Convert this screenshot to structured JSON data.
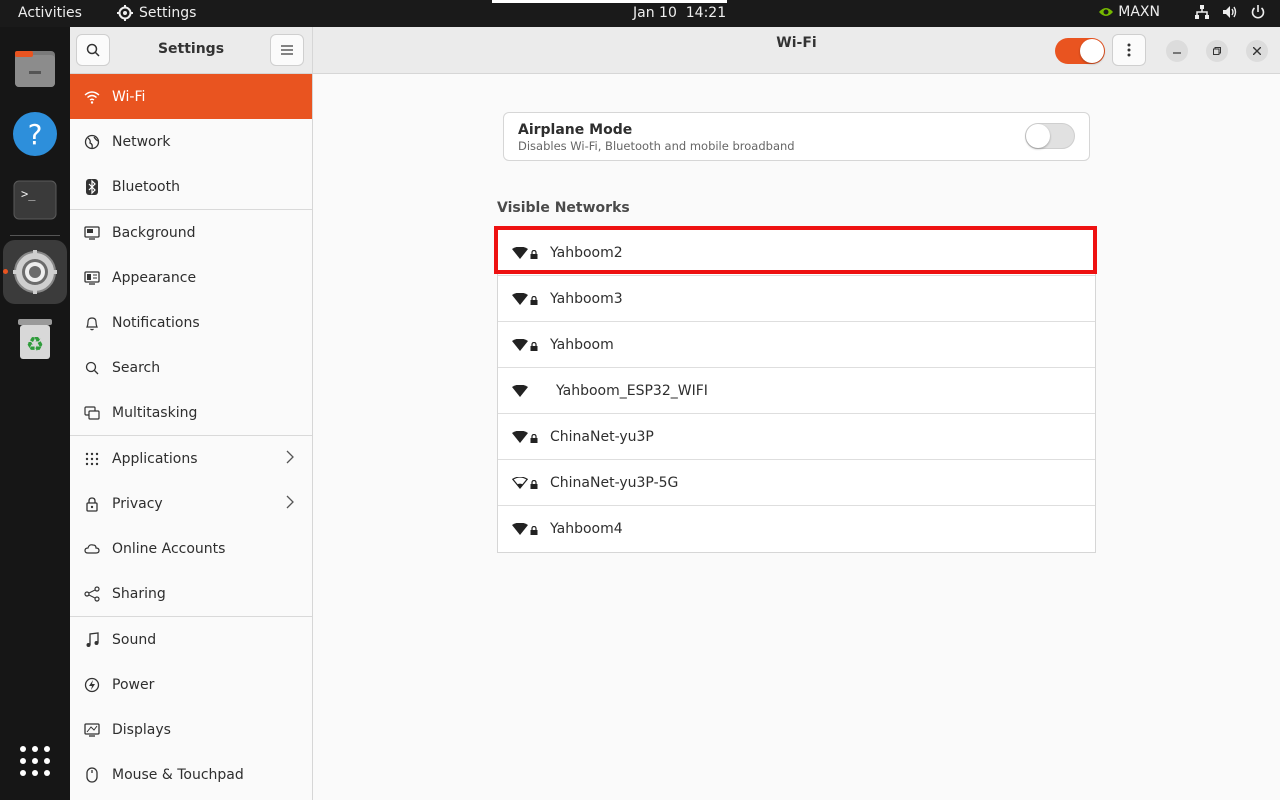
{
  "topbar": {
    "activities": "Activities",
    "app_name": "Settings",
    "date": "Jan 10",
    "time": "14:21",
    "power_mode": "MAXN"
  },
  "dock": {
    "items": [
      {
        "name": "files"
      },
      {
        "name": "help"
      },
      {
        "name": "terminal"
      },
      {
        "name": "settings"
      },
      {
        "name": "trash"
      },
      {
        "name": "show-apps"
      }
    ]
  },
  "sidebar": {
    "title": "Settings",
    "items": [
      {
        "label": "Wi-Fi",
        "icon": "wifi-icon"
      },
      {
        "label": "Network",
        "icon": "globe-icon"
      },
      {
        "label": "Bluetooth",
        "icon": "bluetooth-icon"
      },
      {
        "label": "Background",
        "icon": "monitor-icon"
      },
      {
        "label": "Appearance",
        "icon": "appearance-icon"
      },
      {
        "label": "Notifications",
        "icon": "bell-icon"
      },
      {
        "label": "Search",
        "icon": "search-icon"
      },
      {
        "label": "Multitasking",
        "icon": "multitasking-icon"
      },
      {
        "label": "Applications",
        "icon": "grid-icon"
      },
      {
        "label": "Privacy",
        "icon": "lock-icon"
      },
      {
        "label": "Online Accounts",
        "icon": "cloud-icon"
      },
      {
        "label": "Sharing",
        "icon": "share-icon"
      },
      {
        "label": "Sound",
        "icon": "music-note-icon"
      },
      {
        "label": "Power",
        "icon": "power-icon"
      },
      {
        "label": "Displays",
        "icon": "display-icon"
      },
      {
        "label": "Mouse & Touchpad",
        "icon": "mouse-icon"
      }
    ]
  },
  "main": {
    "title": "Wi-Fi",
    "wifi_enabled": true,
    "airplane": {
      "title": "Airplane Mode",
      "subtitle": "Disables Wi-Fi, Bluetooth and mobile broadband",
      "enabled": false
    },
    "visible_networks_label": "Visible Networks",
    "networks": [
      {
        "name": "Yahboom2",
        "secured": true,
        "signal": "full"
      },
      {
        "name": "Yahboom3",
        "secured": true,
        "signal": "full"
      },
      {
        "name": "Yahboom",
        "secured": true,
        "signal": "full"
      },
      {
        "name": "Yahboom_ESP32_WIFI",
        "secured": false,
        "signal": "full"
      },
      {
        "name": "ChinaNet-yu3P",
        "secured": true,
        "signal": "full"
      },
      {
        "name": "ChinaNet-yu3P-5G",
        "secured": true,
        "signal": "weak"
      },
      {
        "name": "Yahboom4",
        "secured": true,
        "signal": "full"
      }
    ]
  },
  "colors": {
    "accent": "#e95420",
    "highlight": "#ee1111"
  }
}
